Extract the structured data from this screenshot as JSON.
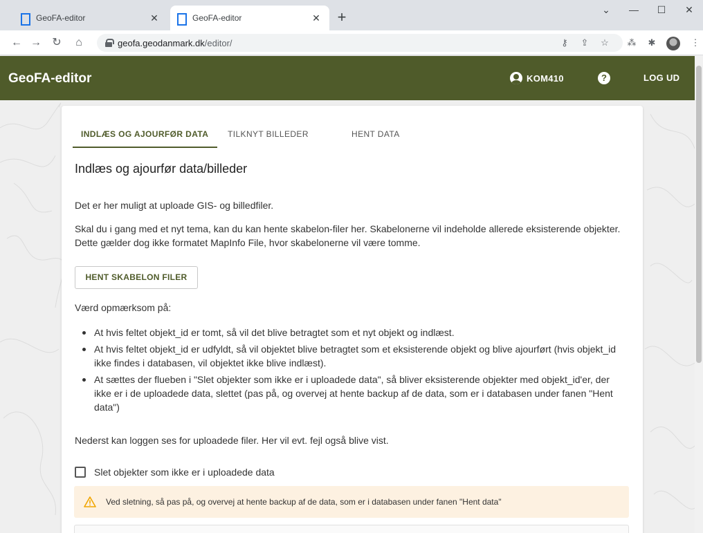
{
  "browser": {
    "tabs": [
      {
        "title": "GeoFA-editor",
        "active": false
      },
      {
        "title": "GeoFA-editor",
        "active": true
      }
    ],
    "new_tab": "+",
    "url_host": "geofa.geodanmark.dk",
    "url_path": "/editor/"
  },
  "header": {
    "title": "GeoFA-editor",
    "user": "KOM410",
    "help": "?",
    "logout": "LOG UD"
  },
  "tabs": [
    {
      "label": "INDLÆS OG AJOURFØR DATA",
      "active": true
    },
    {
      "label": "TILKNYT BILLEDER",
      "active": false
    },
    {
      "label": "HENT DATA",
      "active": false
    }
  ],
  "content": {
    "heading": "Indlæs og ajourfør data/billeder",
    "intro": "Det er her muligt at uploade GIS- og billedfiler.",
    "template_text": "Skal du i gang med et nyt tema, kan du kan hente skabelon-filer her. Skabelonerne vil indeholde allerede eksisterende objekter. Dette gælder dog ikke formatet MapInfo File, hvor skabelonerne vil være tomme.",
    "template_button": "HENT SKABELON FILER",
    "notice_heading": "Værd opmærksom på:",
    "bullets": [
      "At hvis feltet objekt_id er tomt, så vil det blive betragtet som et nyt objekt og indlæst.",
      "At hvis feltet objekt_id er udfyldt, så vil objektet blive betragtet som et eksisterende objekt og blive ajourført (hvis objekt_id ikke findes i databasen, vil objektet ikke blive indlæst).",
      "At sættes der flueben i \"Slet objekter som ikke er i uploadede data\", så bliver eksisterende objekter med objekt_id'er, der ikke er i de uploadede data, slettet (pas på, og overvej at hente backup af de data, som er i databasen under fanen \"Hent data\")"
    ],
    "log_text": "Nederst kan loggen ses for uploadede filer. Her vil evt. fejl også blive vist.",
    "checkbox_label": "Slet objekter som ikke er i uploadede data",
    "checkbox_checked": false,
    "warning": "Ved sletning, så pas på, og overvej at hente backup af de data, som er i databasen under fanen \"Hent data\""
  },
  "colors": {
    "brand": "#4f5b2a",
    "warning_bg": "#fdf1e1",
    "warning_icon": "#f0a500"
  }
}
